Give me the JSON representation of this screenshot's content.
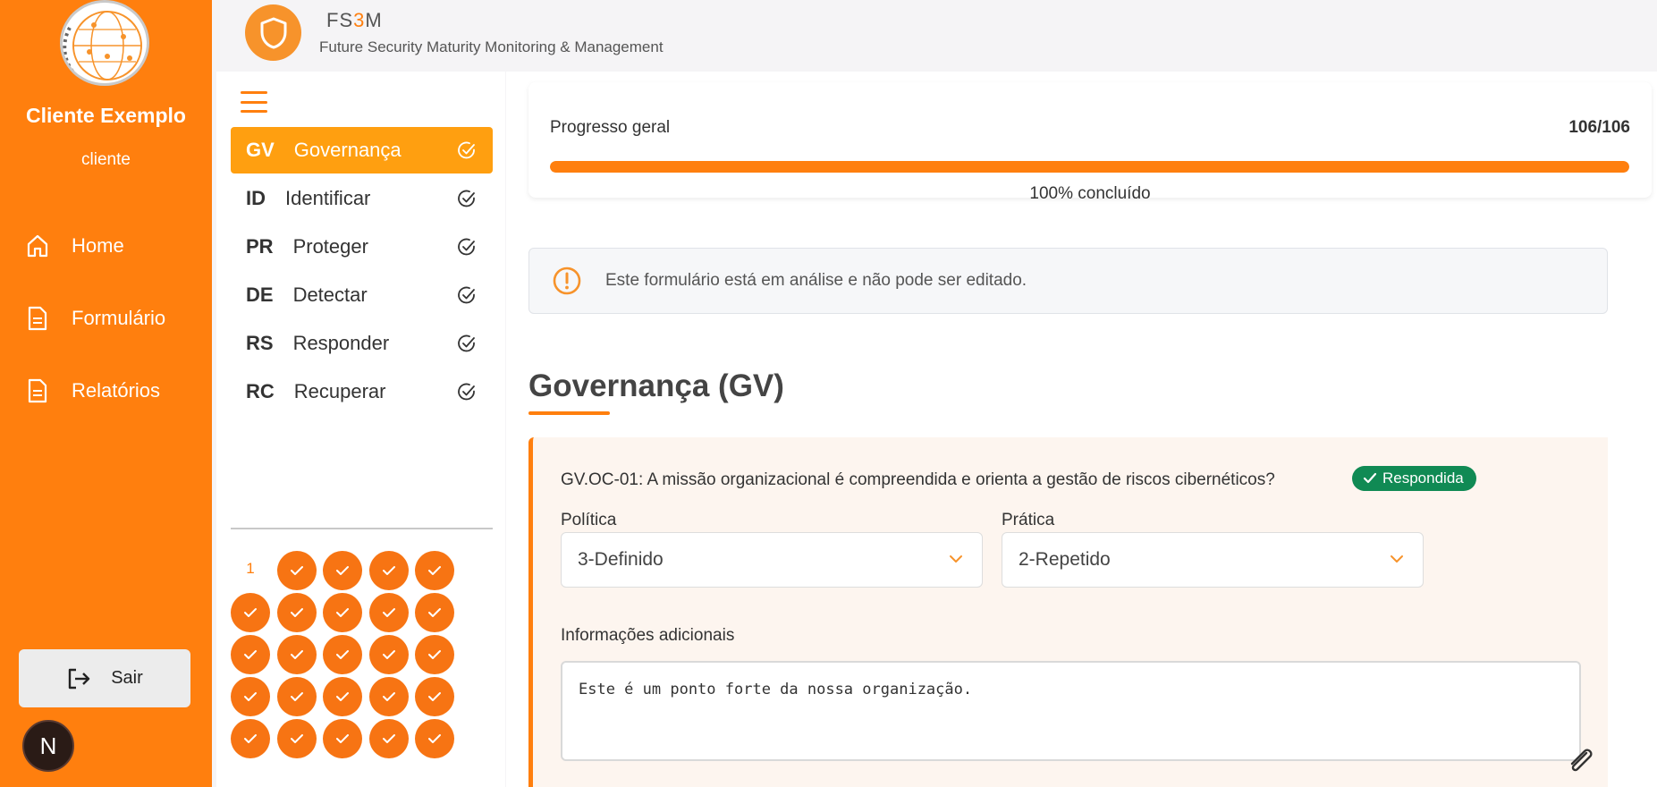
{
  "sidebar": {
    "client_name": "Cliente Exemplo",
    "client_role": "cliente",
    "nav": [
      {
        "label": "Home",
        "icon": "home-icon"
      },
      {
        "label": "Formulário",
        "icon": "document-icon"
      },
      {
        "label": "Relatórios",
        "icon": "document-icon"
      }
    ],
    "logout_label": "Sair",
    "badge_letter": "N"
  },
  "header": {
    "brand_prefix": "FS",
    "brand_highlight": "3",
    "brand_suffix": "M",
    "subtitle": "Future Security Maturity Monitoring & Management"
  },
  "functions": [
    {
      "code": "GV",
      "name": "Governança",
      "active": true
    },
    {
      "code": "ID",
      "name": "Identificar",
      "active": false
    },
    {
      "code": "PR",
      "name": "Proteger",
      "active": false
    },
    {
      "code": "DE",
      "name": "Detectar",
      "active": false
    },
    {
      "code": "RS",
      "name": "Responder",
      "active": false
    },
    {
      "code": "RC",
      "name": "Recuperar",
      "active": false
    }
  ],
  "question_nav": {
    "current_number": "1"
  },
  "progress": {
    "label": "Progresso geral",
    "count": "106/106",
    "percent_text": "100% concluído",
    "fraction": 1.0
  },
  "alert": {
    "text": "Este formulário está em análise e não pode ser editado."
  },
  "section": {
    "title": "Governança (GV)"
  },
  "question": {
    "text": "GV.OC-01: A missão organizacional é compreendida e orienta a gestão de riscos cibernéticos?",
    "status": "Respondida",
    "policy_label": "Política",
    "policy_value": "3-Definido",
    "practice_label": "Prática",
    "practice_value": "2-Repetido",
    "info_label": "Informações adicionais",
    "info_value": "Este é um ponto forte da nossa organização."
  },
  "colors": {
    "accent": "#ff7f0e",
    "success": "#108a54"
  }
}
